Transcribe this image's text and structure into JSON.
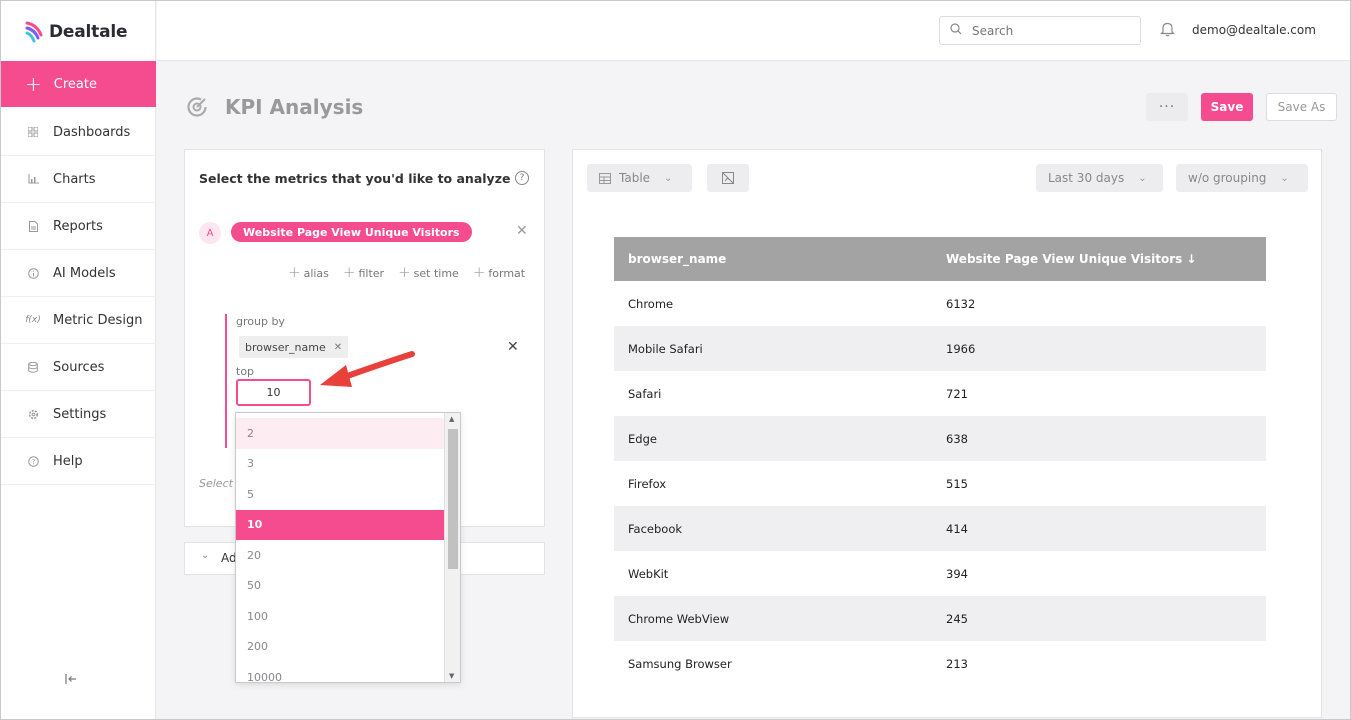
{
  "app": {
    "name": "Dealtale"
  },
  "sidebar": {
    "create_label": "Create",
    "items": [
      {
        "label": "Dashboards",
        "icon": "grid-icon"
      },
      {
        "label": "Charts",
        "icon": "bar-chart-icon"
      },
      {
        "label": "Reports",
        "icon": "document-icon"
      },
      {
        "label": "AI Models",
        "icon": "info-icon"
      },
      {
        "label": "Metric Design",
        "icon": "function-icon"
      },
      {
        "label": "Sources",
        "icon": "database-icon"
      },
      {
        "label": "Settings",
        "icon": "gear-icon"
      },
      {
        "label": "Help",
        "icon": "help-icon"
      }
    ]
  },
  "topbar": {
    "search_placeholder": "Search",
    "user_email": "demo@dealtale.com"
  },
  "page": {
    "title": "KPI Analysis",
    "more_label": "···",
    "save_label": "Save",
    "save_as_label": "Save As"
  },
  "metrics_panel": {
    "heading": "Select the metrics that you'd like to analyze",
    "metric_letter": "A",
    "metric_name": "Website Page View Unique Visitors",
    "actions": {
      "alias": "alias",
      "filter": "filter",
      "set_time": "set time",
      "format": "format"
    },
    "group_by_label": "group by",
    "group_tag": "browser_name",
    "top_label": "top",
    "top_value": "10",
    "select_hint": "Select c",
    "advanced_label": "Ad"
  },
  "top_dropdown": {
    "options": [
      "2",
      "3",
      "5",
      "10",
      "20",
      "50",
      "100",
      "200",
      "10000"
    ],
    "selected": "10",
    "hovered": "2"
  },
  "controls": {
    "view_label": "Table",
    "date_range": "Last 30 days",
    "grouping": "w/o grouping"
  },
  "table": {
    "columns": [
      "browser_name",
      "Website Page View Unique Visitors ↓"
    ],
    "rows": [
      [
        "Chrome",
        "6132"
      ],
      [
        "Mobile Safari",
        "1966"
      ],
      [
        "Safari",
        "721"
      ],
      [
        "Edge",
        "638"
      ],
      [
        "Firefox",
        "515"
      ],
      [
        "Facebook",
        "414"
      ],
      [
        "WebKit",
        "394"
      ],
      [
        "Chrome WebView",
        "245"
      ],
      [
        "Samsung Browser",
        "213"
      ]
    ]
  },
  "colors": {
    "accent": "#f54b8f",
    "header_gray": "#a3a3a3",
    "annotation_red": "#e8413b"
  }
}
